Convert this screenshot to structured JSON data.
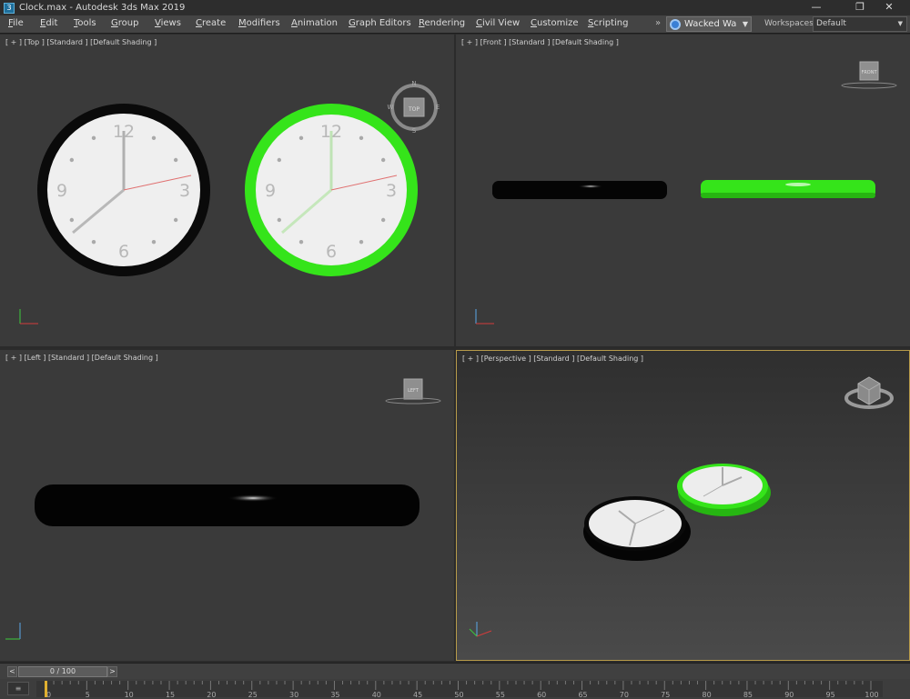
{
  "window": {
    "title": "Clock.max - Autodesk 3ds Max 2019",
    "app_icon": "3ds-max-icon",
    "controls": [
      "minimize-icon",
      "restore-icon",
      "close-icon"
    ]
  },
  "menubar": {
    "items": [
      "File",
      "Edit",
      "Tools",
      "Group",
      "Views",
      "Create",
      "Modifiers",
      "Animation",
      "Graph Editors",
      "Rendering",
      "Civil View",
      "Customize",
      "Scripting"
    ],
    "overflow": "»",
    "user": "Wacked Wa",
    "workspaces_label": "Workspaces:",
    "workspace_value": "Default"
  },
  "viewports": {
    "top": {
      "label": "[ + ] [Top ] [Standard ] [Default Shading ]",
      "nav_cube_label": "TOP",
      "compass": [
        "N",
        "E",
        "S",
        "W"
      ]
    },
    "front": {
      "label": "[ + ] [Front ] [Standard ] [Default Shading ]",
      "nav_cube_label": "FRONT"
    },
    "left": {
      "label": "[ + ] [Left ] [Standard ] [Default Shading ]",
      "nav_cube_label": "LEFT"
    },
    "perspective": {
      "label": "[ + ] [Perspective ] [Standard ] [Default Shading ]",
      "nav_cube_label": ""
    }
  },
  "clock": {
    "numerals": [
      "12",
      "3",
      "6",
      "9"
    ],
    "black_frame": "#0a0a0a",
    "green_frame": "#35e41a",
    "face": "#efefef"
  },
  "timeline": {
    "prev": "<",
    "next": ">",
    "frame_text": "0 / 100",
    "ticks": [
      "0",
      "5",
      "10",
      "15",
      "20",
      "25",
      "30",
      "35",
      "40",
      "45",
      "50",
      "55",
      "60",
      "65",
      "70",
      "75",
      "80",
      "85",
      "90",
      "95",
      "100"
    ],
    "corner_icon": "key-filter-icon"
  }
}
